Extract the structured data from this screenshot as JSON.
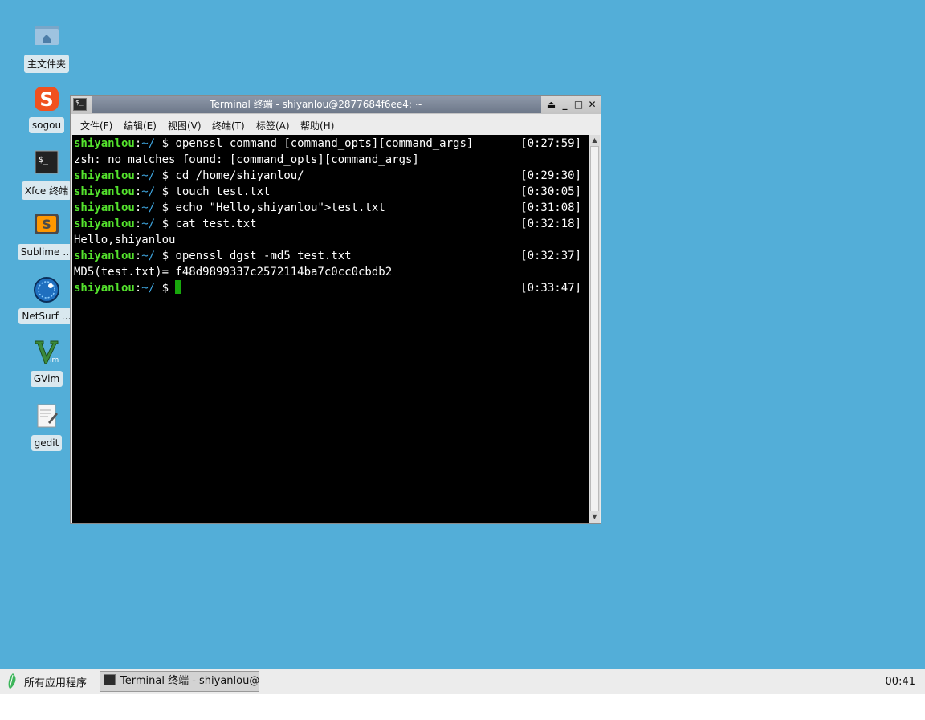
{
  "desktop": {
    "icons": [
      {
        "label": "主文件夹",
        "icon": "home-folder-icon"
      },
      {
        "label": "sogou",
        "icon": "sogou-icon"
      },
      {
        "label": "Xfce 终端",
        "icon": "terminal-icon"
      },
      {
        "label": "Sublime …",
        "icon": "sublime-icon"
      },
      {
        "label": "NetSurf …",
        "icon": "netsurf-icon"
      },
      {
        "label": "GVim",
        "icon": "gvim-icon"
      },
      {
        "label": "gedit",
        "icon": "gedit-icon"
      }
    ]
  },
  "window": {
    "title": "Terminal 终端 - shiyanlou@2877684f6ee4: ~",
    "menu": [
      "文件(F)",
      "编辑(E)",
      "视图(V)",
      "终端(T)",
      "标签(A)",
      "帮助(H)"
    ],
    "prompt": {
      "user": "shiyanlou",
      "sep": ":",
      "path": "~/",
      "symbol": "$"
    },
    "lines": [
      {
        "type": "cmd",
        "text": "openssl command [command_opts][command_args]",
        "time": "[0:27:59]"
      },
      {
        "type": "out",
        "text": "zsh: no matches found: [command_opts][command_args]"
      },
      {
        "type": "cmd",
        "text": "cd /home/shiyanlou/",
        "time": "[0:29:30]"
      },
      {
        "type": "cmd",
        "text": "touch test.txt",
        "time": "[0:30:05]"
      },
      {
        "type": "cmd",
        "text": "echo \"Hello,shiyanlou\">test.txt",
        "time": "[0:31:08]"
      },
      {
        "type": "cmd",
        "text": "cat test.txt",
        "time": "[0:32:18]"
      },
      {
        "type": "out",
        "text": "Hello,shiyanlou"
      },
      {
        "type": "cmd",
        "text": "openssl dgst -md5 test.txt",
        "time": "[0:32:37]"
      },
      {
        "type": "out",
        "text": "MD5(test.txt)= f48d9899337c2572114ba7c0cc0cbdb2"
      },
      {
        "type": "cmd",
        "text": "",
        "time": "[0:33:47]",
        "cursor": true
      }
    ]
  },
  "taskbar": {
    "apps_menu": "所有应用程序",
    "task": "Terminal 终端 - shiyanlou@…",
    "clock": "00:41"
  }
}
